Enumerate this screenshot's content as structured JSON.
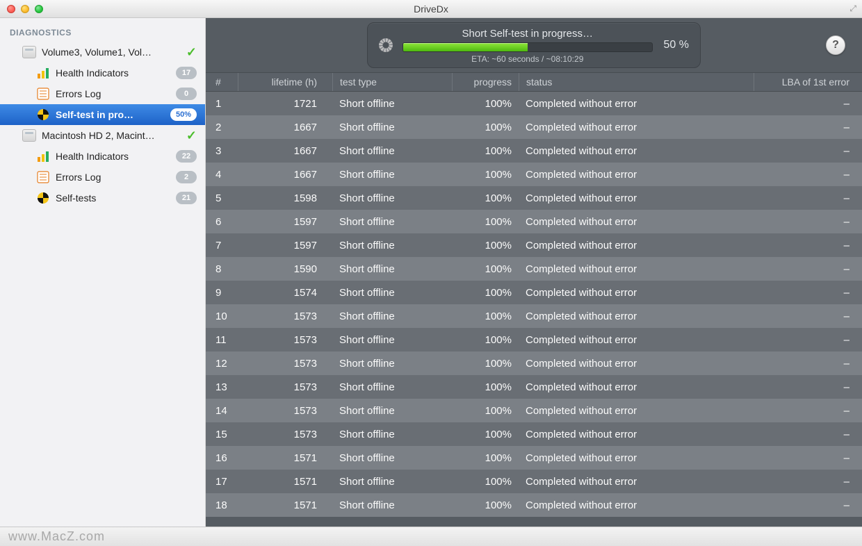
{
  "window": {
    "title": "DriveDx"
  },
  "sidebar": {
    "section": "DIAGNOSTICS",
    "drives": [
      {
        "name": "Volume3, Volume1, Vol…",
        "status_icon": "check",
        "children": [
          {
            "icon": "bars",
            "label": "Health Indicators",
            "badge": "17",
            "selected": false
          },
          {
            "icon": "log",
            "label": "Errors Log",
            "badge": "0",
            "selected": false
          },
          {
            "icon": "selftest",
            "label": "Self-test in pro…",
            "badge": "50%",
            "selected": true
          }
        ]
      },
      {
        "name": "Macintosh HD 2, Macint…",
        "status_icon": "check",
        "children": [
          {
            "icon": "bars",
            "label": "Health Indicators",
            "badge": "22",
            "selected": false
          },
          {
            "icon": "log",
            "label": "Errors Log",
            "badge": "2",
            "selected": false
          },
          {
            "icon": "selftest",
            "label": "Self-tests",
            "badge": "21",
            "selected": false
          }
        ]
      }
    ]
  },
  "progress": {
    "title": "Short Self-test in progress…",
    "eta": "ETA: ~60 seconds / ~08:10:29",
    "percent_text": "50 %",
    "percent_value": 50
  },
  "table": {
    "columns": {
      "idx": "#",
      "lifetime": "lifetime (h)",
      "type": "test type",
      "progress": "progress",
      "status": "status",
      "lba": "LBA of 1st error"
    },
    "rows": [
      {
        "idx": "1",
        "lifetime": "1721",
        "type": "Short offline",
        "progress": "100%",
        "status": "Completed without error",
        "lba": "–"
      },
      {
        "idx": "2",
        "lifetime": "1667",
        "type": "Short offline",
        "progress": "100%",
        "status": "Completed without error",
        "lba": "–"
      },
      {
        "idx": "3",
        "lifetime": "1667",
        "type": "Short offline",
        "progress": "100%",
        "status": "Completed without error",
        "lba": "–"
      },
      {
        "idx": "4",
        "lifetime": "1667",
        "type": "Short offline",
        "progress": "100%",
        "status": "Completed without error",
        "lba": "–"
      },
      {
        "idx": "5",
        "lifetime": "1598",
        "type": "Short offline",
        "progress": "100%",
        "status": "Completed without error",
        "lba": "–"
      },
      {
        "idx": "6",
        "lifetime": "1597",
        "type": "Short offline",
        "progress": "100%",
        "status": "Completed without error",
        "lba": "–"
      },
      {
        "idx": "7",
        "lifetime": "1597",
        "type": "Short offline",
        "progress": "100%",
        "status": "Completed without error",
        "lba": "–"
      },
      {
        "idx": "8",
        "lifetime": "1590",
        "type": "Short offline",
        "progress": "100%",
        "status": "Completed without error",
        "lba": "–"
      },
      {
        "idx": "9",
        "lifetime": "1574",
        "type": "Short offline",
        "progress": "100%",
        "status": "Completed without error",
        "lba": "–"
      },
      {
        "idx": "10",
        "lifetime": "1573",
        "type": "Short offline",
        "progress": "100%",
        "status": "Completed without error",
        "lba": "–"
      },
      {
        "idx": "11",
        "lifetime": "1573",
        "type": "Short offline",
        "progress": "100%",
        "status": "Completed without error",
        "lba": "–"
      },
      {
        "idx": "12",
        "lifetime": "1573",
        "type": "Short offline",
        "progress": "100%",
        "status": "Completed without error",
        "lba": "–"
      },
      {
        "idx": "13",
        "lifetime": "1573",
        "type": "Short offline",
        "progress": "100%",
        "status": "Completed without error",
        "lba": "–"
      },
      {
        "idx": "14",
        "lifetime": "1573",
        "type": "Short offline",
        "progress": "100%",
        "status": "Completed without error",
        "lba": "–"
      },
      {
        "idx": "15",
        "lifetime": "1573",
        "type": "Short offline",
        "progress": "100%",
        "status": "Completed without error",
        "lba": "–"
      },
      {
        "idx": "16",
        "lifetime": "1571",
        "type": "Short offline",
        "progress": "100%",
        "status": "Completed without error",
        "lba": "–"
      },
      {
        "idx": "17",
        "lifetime": "1571",
        "type": "Short offline",
        "progress": "100%",
        "status": "Completed without error",
        "lba": "–"
      },
      {
        "idx": "18",
        "lifetime": "1571",
        "type": "Short offline",
        "progress": "100%",
        "status": "Completed without error",
        "lba": "–"
      }
    ]
  },
  "statusbar": {
    "text": "www.MacZ.com"
  }
}
